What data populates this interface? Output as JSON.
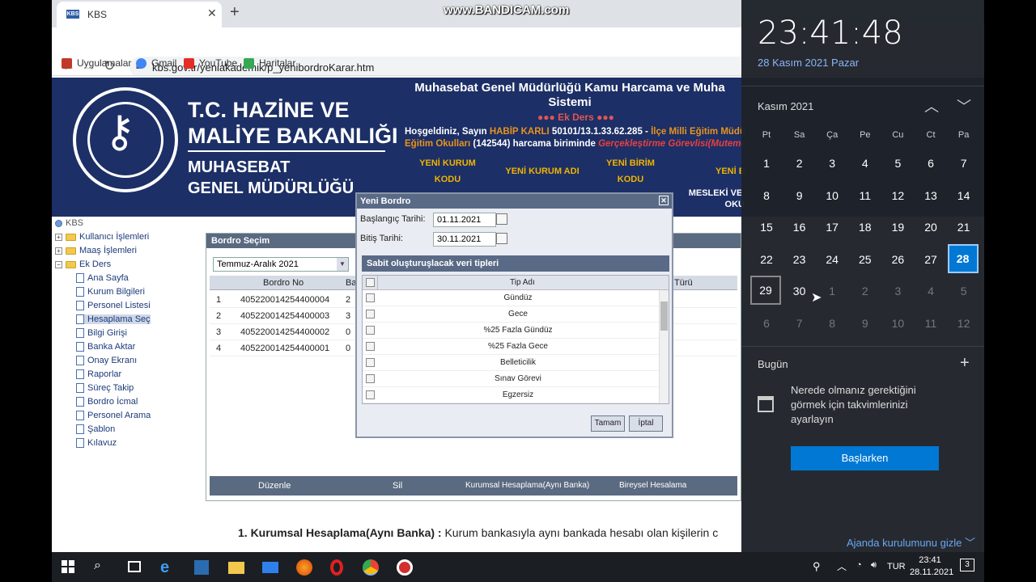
{
  "browser": {
    "tab_title": "KBS",
    "tab_favicon": "KBS",
    "url": "kbs.gov.tr/yeniakademik/p_yenibordroKarar.htm",
    "bookmarks": [
      "Uygulamalar",
      "Gmail",
      "YouTube",
      "Haritalar"
    ]
  },
  "watermark": "www.BANDICAM.com",
  "banner": {
    "line1": "T.C. HAZİNE VE",
    "line2": "MALİYE BAKANLIĞI",
    "line3": "MUHASEBAT",
    "line4": "GENEL MÜDÜRLÜĞÜ",
    "system_title": "Muhasebat Genel Müdürlüğü Kamu Harcama ve Muha",
    "system_title2": "Sistemi",
    "module": "●●● Ek Ders ●●●",
    "welcome": "Hoşgeldiniz, Sayın",
    "user": "HABİP KARLI",
    "code": "50101/13.1.33.62.285 -",
    "unit": "İlçe Milli Eğitim Müdürlü",
    "unit2": "Eğitim Okulları",
    "unit_no": "(142544) harcama biriminde",
    "role": "Gerçekleştirme Görevlisi(Mutemet",
    "col1a": "YENİ KURUM",
    "col1b": "KODU",
    "col2": "YENİ KURUM ADI",
    "col3a": "YENİ BİRİM",
    "col3b": "KODU",
    "col4": "YENİ B",
    "col5a": "MESLEKİ VE",
    "col5b": "OKU"
  },
  "tree": {
    "root": "KBS",
    "folders": [
      "Kullanıcı İşlemleri",
      "Maaş İşlemleri",
      "Ek Ders"
    ],
    "items": [
      "Ana Sayfa",
      "Kurum Bilgileri",
      "Personel Listesi",
      "Hesaplama Seç",
      "Bilgi Girişi",
      "Banka Aktar",
      "Onay Ekranı",
      "Raporlar",
      "Süreç Takip",
      "Bordro İcmal",
      "Personel Arama",
      "Şablon",
      "Kılavuz"
    ]
  },
  "bordro": {
    "title": "Bordro Seçim",
    "period": "Temmuz-Aralık 2021",
    "col_no": "Bordro No",
    "col_bas": "Baş",
    "col_turu": "Türü",
    "rows": [
      {
        "n": "1",
        "no": "405220014254400004",
        "b": "2"
      },
      {
        "n": "2",
        "no": "405220014254400003",
        "b": "3"
      },
      {
        "n": "3",
        "no": "405220014254400002",
        "b": "0"
      },
      {
        "n": "4",
        "no": "405220014254400001",
        "b": "0"
      }
    ],
    "actions": [
      "Düzenle",
      "Sil",
      "Kurumsal Hesaplama(Aynı Banka)",
      "Bireysel Hesalama"
    ]
  },
  "dialog": {
    "title": "Yeni Bordro",
    "start_label": "Başlangıç Tarihi:",
    "start": "01.11.2021",
    "end_label": "Bitiş Tarihi:",
    "end": "30.11.2021",
    "section": "Sabit oluşturuşlacak veri tipleri",
    "col": "Tip Adı",
    "types": [
      "Gündüz",
      "Gece",
      "%25 Fazla Gündüz",
      "%25 Fazla Gece",
      "Belleticilik",
      "Sınav Görevi",
      "Egzersiz"
    ],
    "ok": "Tamam",
    "cancel": "İptal"
  },
  "body_text": {
    "bold": "1. Kurumsal Hesaplama(Aynı Banka) :",
    "rest": "Kurum bankasıyla aynı bankada hesabı olan kişilerin c"
  },
  "calendar": {
    "time": "23:41:48",
    "date": "28 Kasım 2021 Pazar",
    "month": "Kasım 2021",
    "weekdays": [
      "Pt",
      "Sa",
      "Ça",
      "Pe",
      "Cu",
      "Ct",
      "Pa"
    ],
    "days": [
      "1",
      "2",
      "3",
      "4",
      "5",
      "6",
      "7",
      "8",
      "9",
      "10",
      "11",
      "12",
      "13",
      "14",
      "15",
      "16",
      "17",
      "18",
      "19",
      "20",
      "21",
      "22",
      "23",
      "24",
      "25",
      "26",
      "27",
      "28",
      "29",
      "30",
      "1",
      "2",
      "3",
      "4",
      "5",
      "6",
      "7",
      "8",
      "9",
      "10",
      "11",
      "12"
    ],
    "today_label": "Bugün",
    "message": "Nerede olmanız gerektiğini görmek için takvimlerinizi ayarlayın",
    "start_btn": "Başlarken",
    "agenda": "Ajanda kurulumunu gizle"
  },
  "taskbar": {
    "lang": "TUR",
    "time": "23:41",
    "date": "28.11.2021",
    "notif": "3"
  }
}
